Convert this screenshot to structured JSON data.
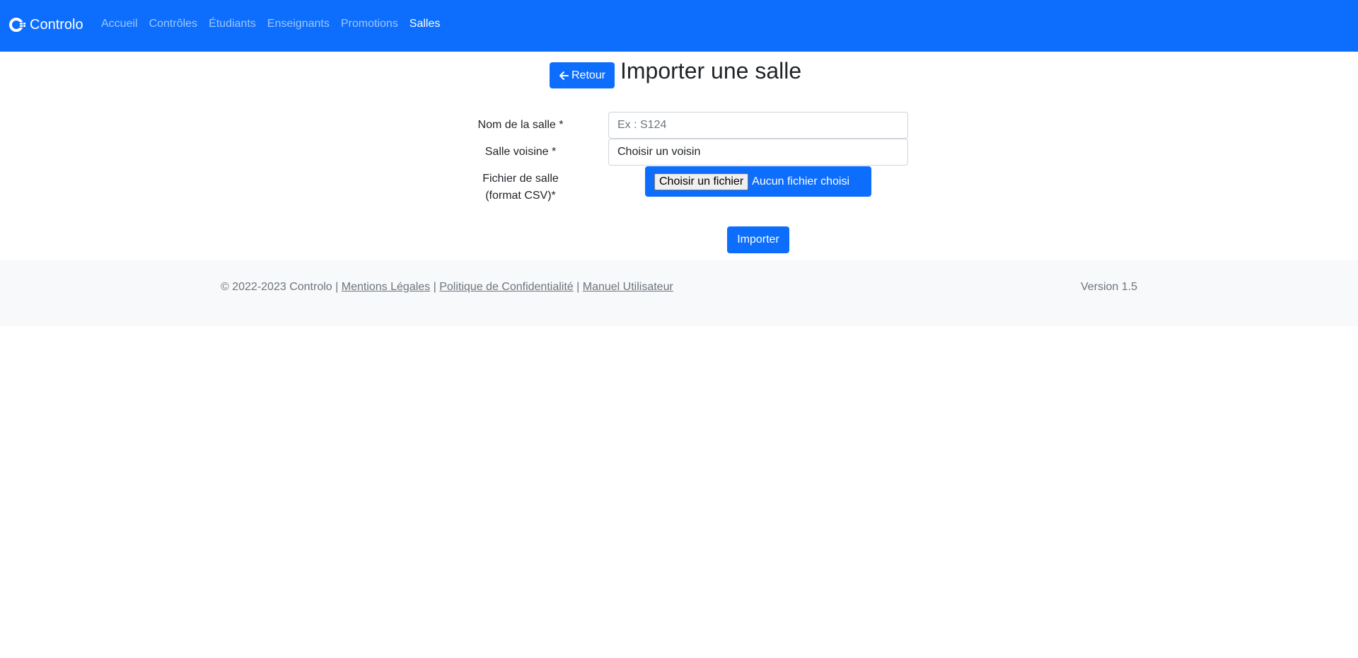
{
  "navbar": {
    "brand": "Controlo",
    "links": [
      "Accueil",
      "Contrôles",
      "Étudiants",
      "Enseignants",
      "Promotions",
      "Salles"
    ],
    "active_index": 5
  },
  "header": {
    "back_label": "Retour",
    "title": "Importer une salle"
  },
  "form": {
    "room_name_label": "Nom de la salle *",
    "room_name_placeholder": "Ex : S124",
    "neighbor_label": "Salle voisine *",
    "neighbor_value": "Choisir un voisin",
    "file_label": "Fichier de salle (format CSV)*",
    "file_button": "Choisir un fichier",
    "file_status": "Aucun fichier choisi",
    "submit_label": "Importer"
  },
  "footer": {
    "copyright": "© 2022-2023 Controlo |",
    "links": [
      "Mentions Légales",
      "Politique de Confidentialité",
      "Manuel Utilisateur"
    ],
    "separator": "|",
    "version": "Version 1.5"
  },
  "colors": {
    "primary": "#0d6efd",
    "footer_bg": "#f8f9fa",
    "muted": "#6c757d"
  }
}
